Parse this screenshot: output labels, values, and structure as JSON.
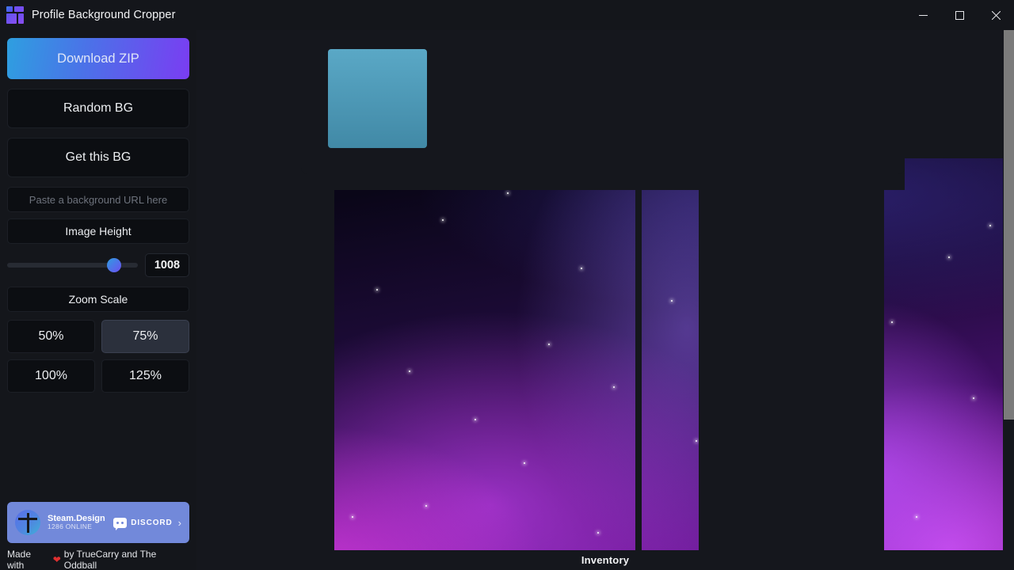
{
  "window": {
    "title": "Profile Background Cropper",
    "icon": "layout-grid-icon",
    "controls": {
      "minimize": "minimize-icon",
      "maximize": "maximize-icon",
      "close": "close-icon"
    }
  },
  "sidebar": {
    "download_zip": "Download ZIP",
    "random_bg": "Random BG",
    "get_this_bg": "Get this BG",
    "url_input_placeholder": "Paste a background URL here",
    "url_input_value": "",
    "image_height_label": "Image Height",
    "image_height_value": "1008",
    "slider_percent": 82,
    "zoom_scale_label": "Zoom Scale",
    "zoom_options": [
      {
        "label": "50%",
        "selected": false
      },
      {
        "label": "75%",
        "selected": true
      },
      {
        "label": "100%",
        "selected": false
      },
      {
        "label": "125%",
        "selected": false
      }
    ],
    "discord": {
      "server_name": "Steam.Design",
      "online_text": "1286 ONLINE",
      "cta_label": "DISCORD",
      "chevron": "›",
      "brand_color": "#7289da"
    },
    "credit": {
      "prefix": "Made with",
      "heart": "❤",
      "suffix": "by TrueCarry and The Oddball"
    }
  },
  "main": {
    "footer_label": "Inventory",
    "avatar_placeholder": "avatar-preview"
  },
  "colors": {
    "accent_start": "#2e9fe0",
    "accent_end": "#7a3df2",
    "panel": "#15171d",
    "surface": "#14161b",
    "button": "#0c0e12",
    "active": "#2b303c",
    "heart": "#e03030",
    "avatar_top": "#5aa8c6",
    "avatar_bottom": "#4189a6",
    "scrollbar": "#7b7b7b"
  }
}
